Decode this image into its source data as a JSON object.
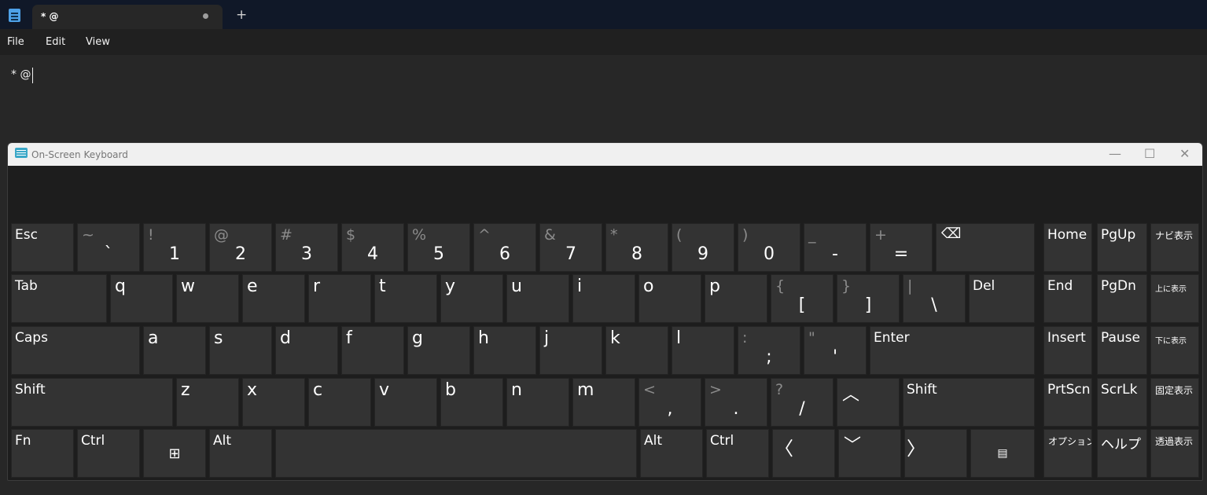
{
  "notepad": {
    "tab_title": "* @",
    "new_tab_glyph": "+",
    "menu": [
      "File",
      "Edit",
      "View"
    ],
    "content": "* @"
  },
  "osk": {
    "title": "On-Screen Keyboard",
    "controls": {
      "minimize": "—",
      "maximize": "☐",
      "close": "✕"
    },
    "rows": {
      "row1": [
        {
          "label": "Esc"
        },
        {
          "shift": "~",
          "main": "`"
        },
        {
          "shift": "!",
          "main": "1"
        },
        {
          "shift": "@",
          "main": "2"
        },
        {
          "shift": "#",
          "main": "3"
        },
        {
          "shift": "$",
          "main": "4"
        },
        {
          "shift": "%",
          "main": "5"
        },
        {
          "shift": "^",
          "main": "6"
        },
        {
          "shift": "&",
          "main": "7"
        },
        {
          "shift": "*",
          "main": "8"
        },
        {
          "shift": "(",
          "main": "9"
        },
        {
          "shift": ")",
          "main": "0"
        },
        {
          "shift": "_",
          "main": "-"
        },
        {
          "shift": "+",
          "main": "="
        },
        {
          "icon": "backspace-icon",
          "glyph": "⌫"
        }
      ],
      "row2": [
        {
          "label": "Tab"
        },
        {
          "letter": "q"
        },
        {
          "letter": "w"
        },
        {
          "letter": "e"
        },
        {
          "letter": "r"
        },
        {
          "letter": "t"
        },
        {
          "letter": "y"
        },
        {
          "letter": "u"
        },
        {
          "letter": "i"
        },
        {
          "letter": "o"
        },
        {
          "letter": "p"
        },
        {
          "shift": "{",
          "main": "["
        },
        {
          "shift": "}",
          "main": "]"
        },
        {
          "shift": "|",
          "main": "\\"
        },
        {
          "label": "Del"
        }
      ],
      "row3": [
        {
          "label": "Caps"
        },
        {
          "letter": "a"
        },
        {
          "letter": "s"
        },
        {
          "letter": "d"
        },
        {
          "letter": "f"
        },
        {
          "letter": "g"
        },
        {
          "letter": "h"
        },
        {
          "letter": "j"
        },
        {
          "letter": "k"
        },
        {
          "letter": "l"
        },
        {
          "shift": ":",
          "main": ";"
        },
        {
          "shift": "\"",
          "main": "'"
        },
        {
          "label": "Enter"
        }
      ],
      "row4": [
        {
          "label": "Shift"
        },
        {
          "letter": "z"
        },
        {
          "letter": "x"
        },
        {
          "letter": "c"
        },
        {
          "letter": "v"
        },
        {
          "letter": "b"
        },
        {
          "letter": "n"
        },
        {
          "letter": "m"
        },
        {
          "shift": "<",
          "main": ","
        },
        {
          "shift": ">",
          "main": "."
        },
        {
          "shift": "?",
          "main": "/"
        },
        {
          "icon": "up-arrow-icon",
          "glyph": "︿"
        },
        {
          "label": "Shift"
        }
      ],
      "row5": [
        {
          "label": "Fn"
        },
        {
          "label": "Ctrl"
        },
        {
          "icon": "windows-icon",
          "glyph": "⊞"
        },
        {
          "label": "Alt"
        },
        {
          "label": ""
        },
        {
          "label": "Alt"
        },
        {
          "label": "Ctrl"
        },
        {
          "icon": "left-arrow-icon",
          "glyph": "〈"
        },
        {
          "icon": "down-arrow-icon",
          "glyph": "﹀"
        },
        {
          "icon": "right-arrow-icon",
          "glyph": "〉"
        },
        {
          "icon": "context-menu-icon",
          "glyph": "▤"
        }
      ]
    },
    "nav": [
      [
        "Home",
        "PgUp",
        "ナビ表示"
      ],
      [
        "End",
        "PgDn",
        "上に表示"
      ],
      [
        "Insert",
        "Pause",
        "下に表示"
      ],
      [
        "PrtScn",
        "ScrLk",
        "固定表示"
      ],
      [
        "オプション",
        "ヘルプ",
        "透過表示"
      ]
    ]
  }
}
